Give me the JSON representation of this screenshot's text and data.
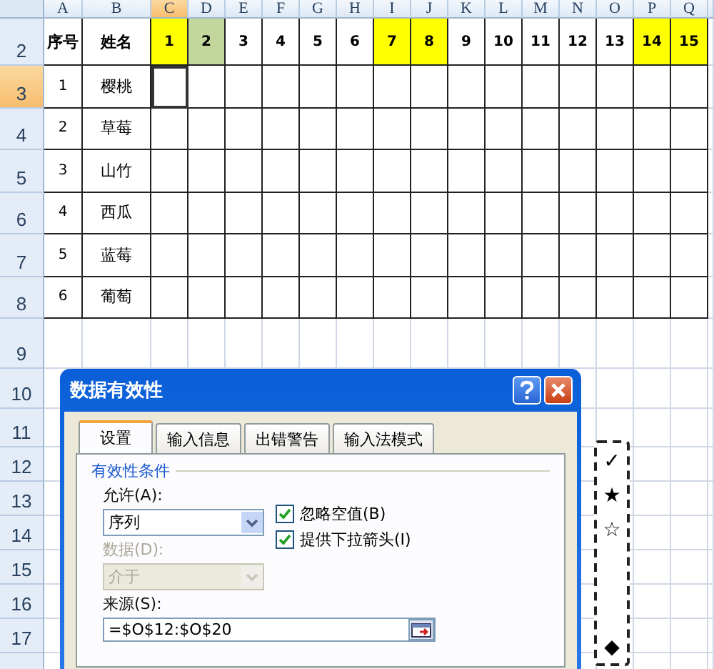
{
  "sheet": {
    "columns": [
      {
        "label": "A",
        "selected": false
      },
      {
        "label": "B",
        "selected": false
      },
      {
        "label": "C",
        "selected": true
      },
      {
        "label": "D",
        "selected": false
      },
      {
        "label": "E",
        "selected": false
      },
      {
        "label": "F",
        "selected": false
      },
      {
        "label": "G",
        "selected": false
      },
      {
        "label": "H",
        "selected": false
      },
      {
        "label": "I",
        "selected": false
      },
      {
        "label": "J",
        "selected": false
      },
      {
        "label": "K",
        "selected": false
      },
      {
        "label": "L",
        "selected": false
      },
      {
        "label": "M",
        "selected": false
      },
      {
        "label": "N",
        "selected": false
      },
      {
        "label": "O",
        "selected": false
      },
      {
        "label": "P",
        "selected": false
      },
      {
        "label": "Q",
        "selected": false
      }
    ],
    "rows": [
      {
        "label": "2",
        "selected": false
      },
      {
        "label": "3",
        "selected": true
      },
      {
        "label": "4",
        "selected": false
      },
      {
        "label": "5",
        "selected": false
      },
      {
        "label": "6",
        "selected": false
      },
      {
        "label": "7",
        "selected": false
      },
      {
        "label": "8",
        "selected": false
      },
      {
        "label": "9",
        "selected": false
      },
      {
        "label": "10",
        "selected": false
      },
      {
        "label": "11",
        "selected": false
      },
      {
        "label": "12",
        "selected": false
      },
      {
        "label": "13",
        "selected": false
      },
      {
        "label": "14",
        "selected": false
      },
      {
        "label": "15",
        "selected": false
      },
      {
        "label": "16",
        "selected": false
      },
      {
        "label": "17",
        "selected": false
      }
    ],
    "headers": [
      {
        "label": "序号"
      },
      {
        "label": "姓名"
      }
    ],
    "days": [
      {
        "label": "1",
        "color": "#ffff00"
      },
      {
        "label": "2",
        "color": "#c3d69b"
      },
      {
        "label": "3",
        "color": "#ffffff"
      },
      {
        "label": "4",
        "color": "#ffffff"
      },
      {
        "label": "5",
        "color": "#ffffff"
      },
      {
        "label": "6",
        "color": "#ffffff"
      },
      {
        "label": "7",
        "color": "#ffff00"
      },
      {
        "label": "8",
        "color": "#ffff00"
      },
      {
        "label": "9",
        "color": "#ffffff"
      },
      {
        "label": "10",
        "color": "#ffffff"
      },
      {
        "label": "11",
        "color": "#ffffff"
      },
      {
        "label": "12",
        "color": "#ffffff"
      },
      {
        "label": "13",
        "color": "#ffffff"
      },
      {
        "label": "14",
        "color": "#ffff00"
      },
      {
        "label": "15",
        "color": "#ffff00"
      }
    ],
    "people": [
      {
        "no": "1",
        "name": "樱桃"
      },
      {
        "no": "2",
        "name": "草莓"
      },
      {
        "no": "3",
        "name": "山竹"
      },
      {
        "no": "4",
        "name": "西瓜"
      },
      {
        "no": "5",
        "name": "蓝莓"
      },
      {
        "no": "6",
        "name": "葡萄"
      }
    ],
    "symbols": [
      "✓",
      "★",
      "☆",
      "◆"
    ]
  },
  "dialog": {
    "title": "数据有效性",
    "tabs": [
      {
        "label": "设置",
        "selected": true
      },
      {
        "label": "输入信息",
        "selected": false
      },
      {
        "label": "出错警告",
        "selected": false
      },
      {
        "label": "输入法模式",
        "selected": false
      }
    ],
    "group_label": "有效性条件",
    "allow": {
      "label": "允许(A):",
      "value": "序列"
    },
    "data": {
      "label": "数据(D):",
      "value": "介于",
      "disabled": true
    },
    "checkboxes": [
      {
        "label": "忽略空值(B)",
        "checked": true
      },
      {
        "label": "提供下拉箭头(I)",
        "checked": true
      }
    ],
    "source": {
      "label": "来源(S):",
      "value": "=$O$12:$O$20"
    }
  }
}
